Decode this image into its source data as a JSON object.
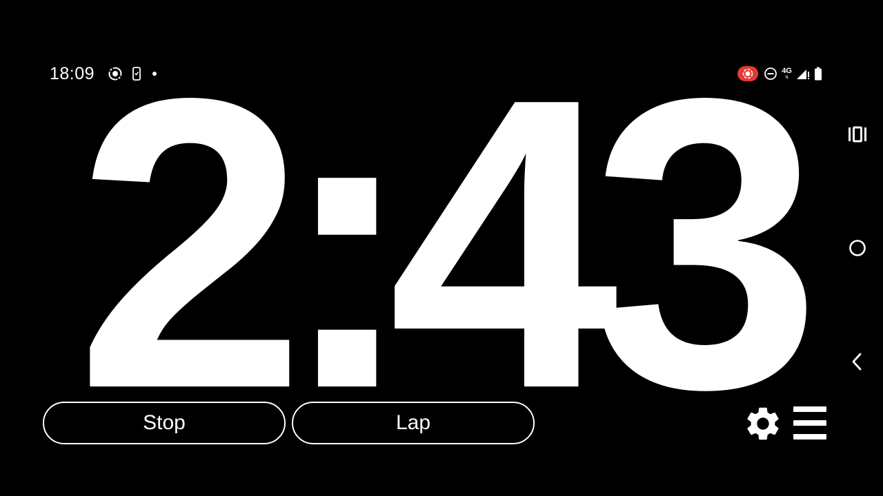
{
  "status_bar": {
    "time": "18:09",
    "left_icons": [
      "screen-record-icon",
      "phone-screen-icon",
      "notification-dot-icon"
    ],
    "right_icons": [
      "recording-badge-icon",
      "do-not-disturb-icon",
      "network-4g-icon",
      "signal-icon",
      "battery-icon"
    ],
    "network": "4G",
    "recording_color": "#e53935"
  },
  "timer": {
    "display": "2:43"
  },
  "controls": {
    "stop_label": "Stop",
    "lap_label": "Lap",
    "settings_icon": "gear-icon",
    "menu_icon": "hamburger-menu-icon"
  },
  "navigation": {
    "icons": [
      "recent-apps-icon",
      "home-icon",
      "back-icon"
    ]
  },
  "colors": {
    "background": "#000000",
    "foreground": "#ffffff",
    "accent": "#e53935"
  }
}
